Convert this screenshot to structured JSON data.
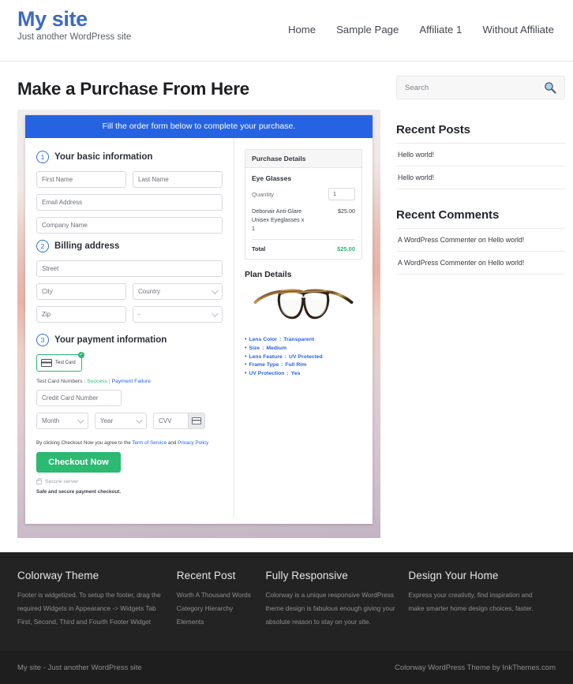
{
  "header": {
    "site_title": "My site",
    "tagline": "Just another WordPress site",
    "nav": [
      {
        "label": "Home"
      },
      {
        "label": "Sample Page"
      },
      {
        "label": "Affiliate 1"
      },
      {
        "label": "Without Affiliate"
      }
    ]
  },
  "page": {
    "title": "Make a Purchase From Here"
  },
  "order_form": {
    "banner": "Fill the order form below to complete your purchase.",
    "step1": {
      "number": "1",
      "label": "Your basic information",
      "first_name_placeholder": "First Name",
      "last_name_placeholder": "Last Name",
      "email_placeholder": "Email Address",
      "company_placeholder": "Company Name"
    },
    "step2": {
      "number": "2",
      "label": "Billing address",
      "street_placeholder": "Street",
      "city_placeholder": "City",
      "country_placeholder": "Country",
      "zip_placeholder": "Zip",
      "state_placeholder": "-"
    },
    "step3": {
      "number": "3",
      "label": "Your payment information",
      "tab_label": "Test Card",
      "check_glyph": "✓",
      "test_cards_label": "Test Card Numbers :",
      "test_card_success": "Success",
      "test_card_separator": "|",
      "test_card_failure": "Payment Failure",
      "card_number_placeholder": "Credit Card Number",
      "month_placeholder": "Month",
      "year_placeholder": "Year",
      "cvv_placeholder": "CVV",
      "terms_prefix": "By clicking Checkout Now you agree to the",
      "terms_link": "Term of Service",
      "terms_and": "and",
      "privacy_link": "Privacy Policy",
      "checkout_button": "Checkout Now",
      "secure_server": "Secure server",
      "safe_note": "Safe and secure payment checkout."
    },
    "purchase_details": {
      "heading": "Purchase Details",
      "product": "Eye Glasses",
      "quantity_label": "Quantity",
      "quantity_value": "1",
      "line_item_name": "Debonair Anti-Glare Unisex Eyeglasses x 1",
      "line_item_price": "$25.00",
      "total_label": "Total",
      "total_value": "$25.00"
    },
    "plan_details": {
      "heading": "Plan Details",
      "specs": [
        {
          "key": "Lens Color",
          "sep": ":",
          "value": "Transparent"
        },
        {
          "key": "Size",
          "sep": ":",
          "value": "Medium"
        },
        {
          "key": "Lens Feature",
          "sep": ":",
          "value": "UV Protected"
        },
        {
          "key": "Frame Type",
          "sep": ":",
          "value": "Full Rim"
        },
        {
          "key": "UV Protection",
          "sep": ":",
          "value": "Yes"
        }
      ]
    }
  },
  "sidebar": {
    "search_placeholder": "Search",
    "recent_posts": {
      "title": "Recent Posts",
      "items": [
        {
          "label": "Hello world!"
        },
        {
          "label": "Hello world!"
        }
      ]
    },
    "recent_comments": {
      "title": "Recent Comments",
      "items": [
        {
          "label": "A WordPress Commenter on Hello world!"
        },
        {
          "label": "A WordPress Commenter on Hello world!"
        }
      ]
    }
  },
  "footer": {
    "columns": [
      {
        "title": "Colorway Theme",
        "text": "Footer is widgetized. To setup the footer, drag the required Widgets in Appearance -> Widgets Tab First, Second, Third and Fourth Footer Widget"
      },
      {
        "title": "Recent Post",
        "items": [
          {
            "label": "Worth A Thousand Words"
          },
          {
            "label": "Category Hierarchy"
          },
          {
            "label": "Elements"
          }
        ]
      },
      {
        "title": "Fully Responsive",
        "text": "Colorway is a unique responsive WordPress theme design is fabulous enough giving your absolute reason to stay on your site."
      },
      {
        "title": "Design Your Home",
        "text": "Express your creativity, find inspiration and make smarter home design choices, faster."
      }
    ],
    "bottom_left": "My site - Just another WordPress site",
    "bottom_right": "Colorway WordPress Theme by InkThemes.com"
  },
  "colors": {
    "brand_blue": "#3d6bbf",
    "banner_blue": "#2663e3",
    "accent_green": "#2cb972",
    "footer_dark": "#232323"
  }
}
